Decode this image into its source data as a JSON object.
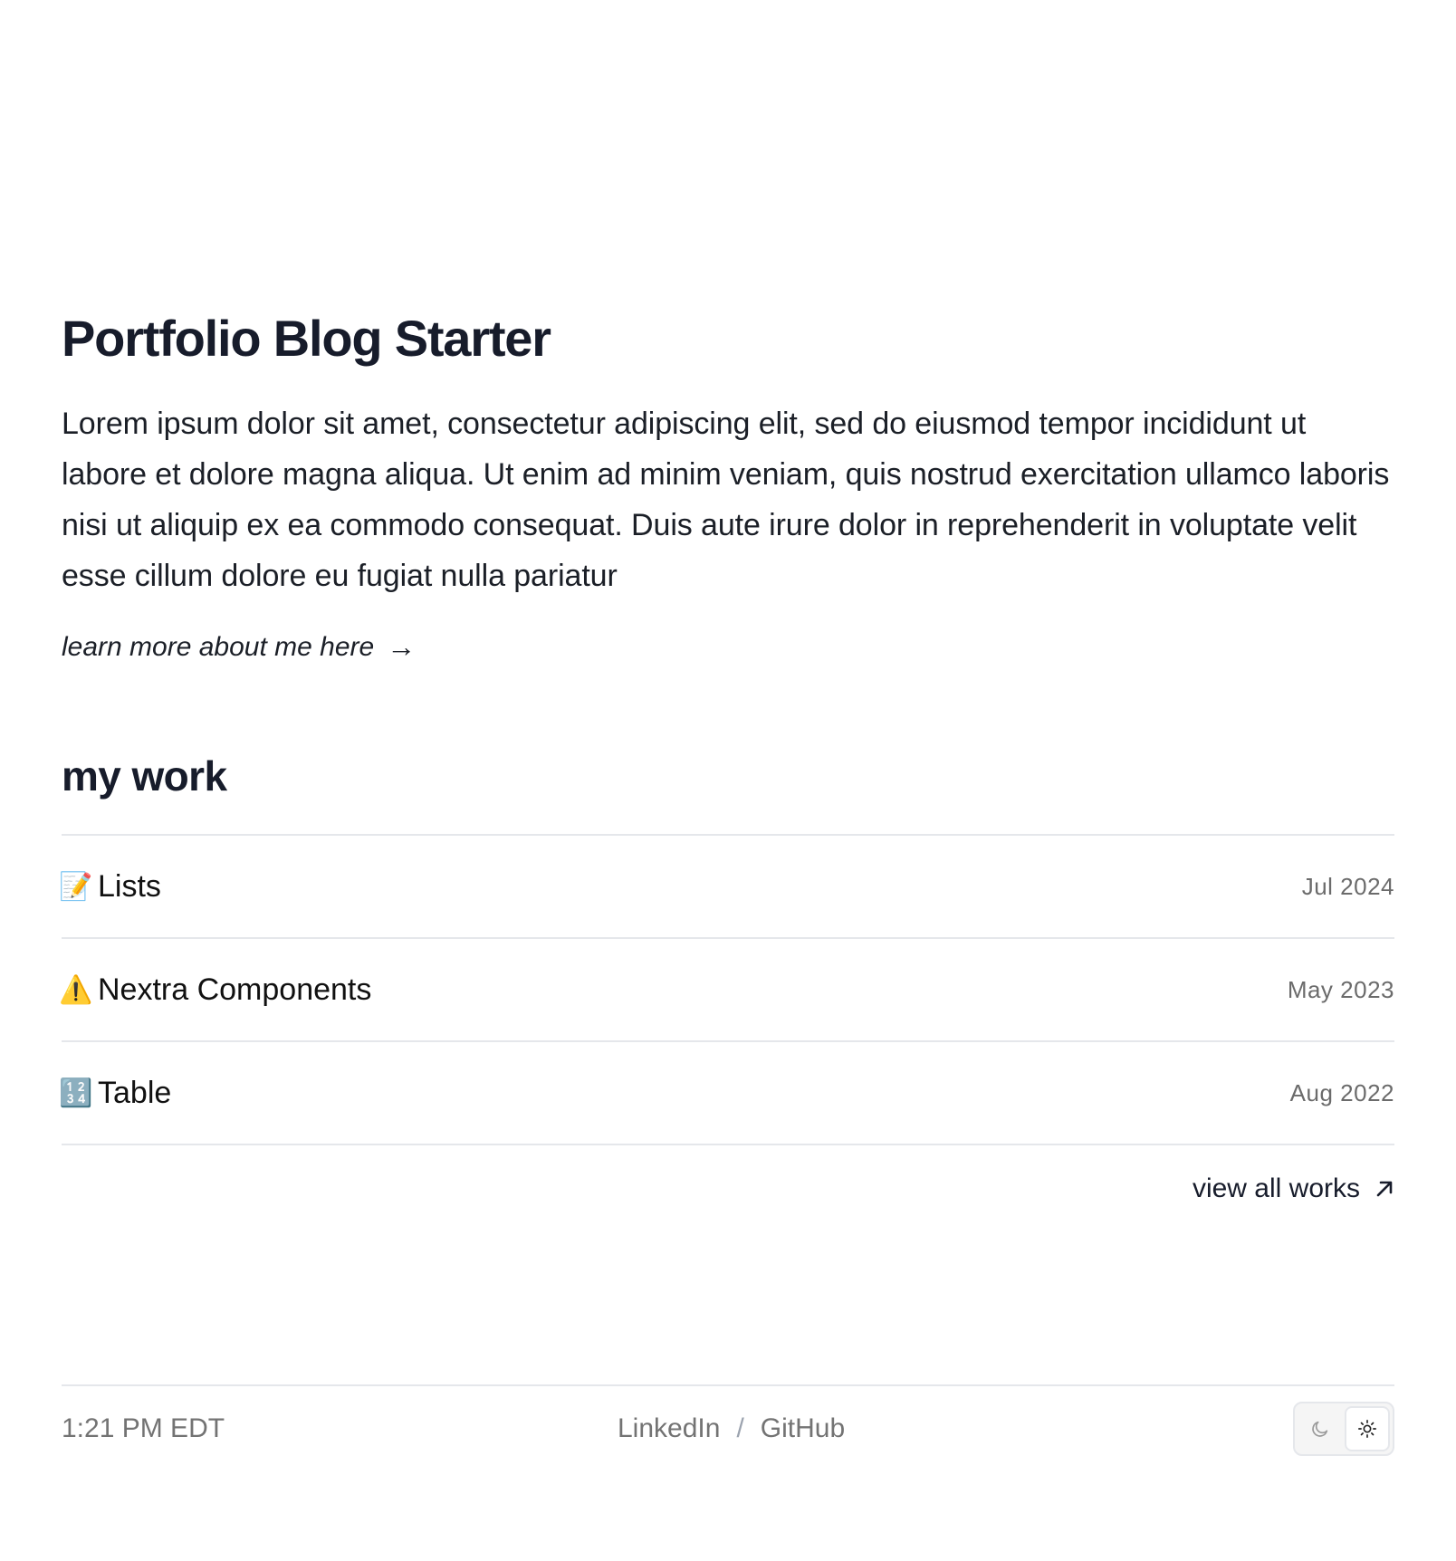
{
  "hero": {
    "title": "Portfolio Blog Starter",
    "intro": "Lorem ipsum dolor sit amet, consectetur adipiscing elit, sed do eiusmod tempor incididunt ut labore et dolore magna aliqua. Ut enim ad minim veniam, quis nostrud exercitation ullamco laboris nisi ut aliquip ex ea commodo consequat. Duis aute irure dolor in reprehenderit in voluptate velit esse cillum dolore eu fugiat nulla pariatur",
    "about_link": "learn more about me here",
    "about_arrow": "→"
  },
  "work": {
    "heading": "my work",
    "items": [
      {
        "emoji": "📝",
        "icon": "memo-icon",
        "title": "Lists",
        "date": "Jul 2024"
      },
      {
        "emoji": "⚠️",
        "icon": "warning-icon",
        "title": "Nextra Components",
        "date": "May 2023"
      },
      {
        "emoji": "🔢",
        "icon": "numbers-icon",
        "title": "Table",
        "date": "Aug 2022"
      }
    ],
    "view_all": "view all works"
  },
  "footer": {
    "time": "1:21 PM EDT",
    "links": {
      "linkedin": "LinkedIn",
      "separator": "/",
      "github": "GitHub"
    },
    "theme": {
      "options": [
        "dark",
        "light"
      ],
      "selected": "light"
    }
  },
  "colors": {
    "heading": "#171c2b",
    "text": "#1b1f27",
    "muted": "#737373",
    "border": "#e5e7eb"
  }
}
